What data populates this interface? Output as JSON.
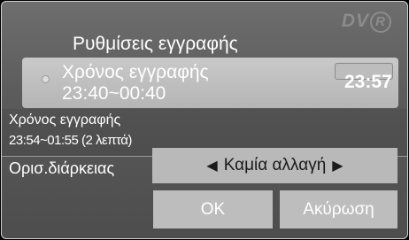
{
  "header": {
    "title": "Ρυθμίσεις εγγραφής",
    "logo_text": "DV",
    "logo_badge": "R"
  },
  "recording": {
    "label": "Χρόνος εγγραφής",
    "range": "23:40~00:40",
    "current_time": "23:57"
  },
  "info": {
    "label": "Χρόνος εγγραφής",
    "range": "23:54~01:55  (2 λεπτά)"
  },
  "duration": {
    "label": "Ορισ.διάρκειας",
    "value": "Καμία αλλαγή",
    "left_arrow": "◀",
    "right_arrow": "▶"
  },
  "buttons": {
    "ok": "OK",
    "cancel": "Ακύρωση"
  }
}
